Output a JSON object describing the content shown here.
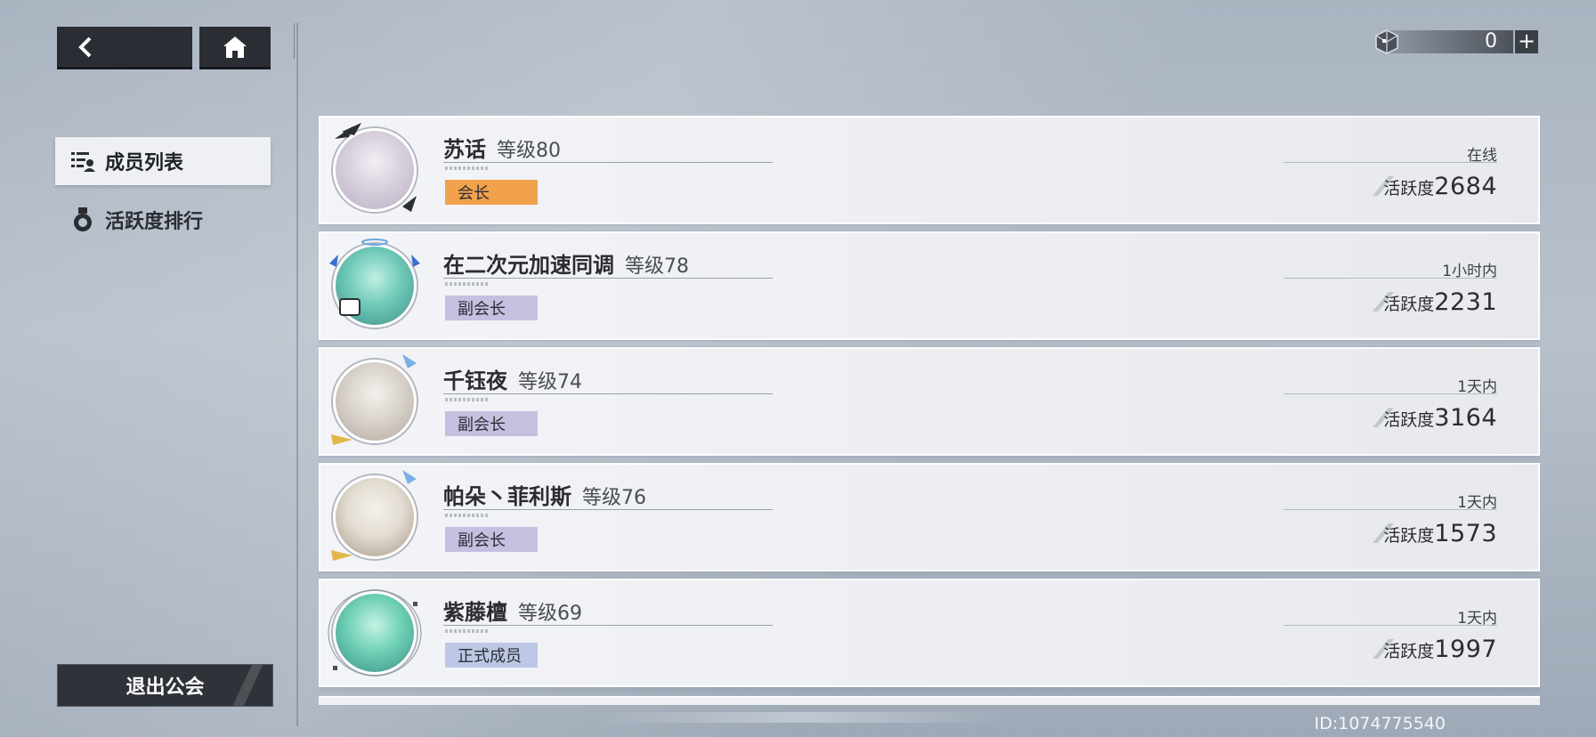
{
  "nav": {
    "back_icon": "chevron-left-icon",
    "home_icon": "home-icon"
  },
  "menu": {
    "items": [
      {
        "label": "成员列表",
        "icon": "member-list-icon",
        "active": true
      },
      {
        "label": "活跃度排行",
        "icon": "medal-icon",
        "active": false
      }
    ],
    "exit_label": "退出公会"
  },
  "currency": {
    "icon": "cube-icon",
    "value": "0",
    "add_label": "+"
  },
  "members": [
    {
      "name": "苏话",
      "level": "等级80",
      "role": "会长",
      "role_color": "#f2a14c",
      "status": "在线",
      "activity_label": "活跃度",
      "activity_value": "2684",
      "avatar_colors": [
        "#d7d0dc",
        "#b9aec4"
      ]
    },
    {
      "name": "在二次元加速同调",
      "level": "等级78",
      "role": "副会长",
      "role_color": "#c5bfe0",
      "status": "1小时内",
      "activity_label": "活跃度",
      "activity_value": "2231",
      "avatar_colors": [
        "#6fc9b8",
        "#3f8f8a"
      ]
    },
    {
      "name": "千钰夜",
      "level": "等级74",
      "role": "副会长",
      "role_color": "#c5bfe0",
      "status": "1天内",
      "activity_label": "活跃度",
      "activity_value": "3164",
      "avatar_colors": [
        "#d9d3cc",
        "#b3a99d"
      ]
    },
    {
      "name": "帕朵丶菲利斯",
      "level": "等级76",
      "role": "副会长",
      "role_color": "#c5bfe0",
      "status": "1天内",
      "activity_label": "活跃度",
      "activity_value": "1573",
      "avatar_colors": [
        "#e2dcd2",
        "#a89886"
      ]
    },
    {
      "name": "紫藤檀",
      "level": "等级69",
      "role": "正式成员",
      "role_color": "#bcc8e6",
      "status": "1天内",
      "activity_label": "活跃度",
      "activity_value": "1997",
      "avatar_colors": [
        "#6fd0b5",
        "#3a8f86"
      ]
    }
  ],
  "footer": {
    "id_text": "ID:1074775540"
  }
}
